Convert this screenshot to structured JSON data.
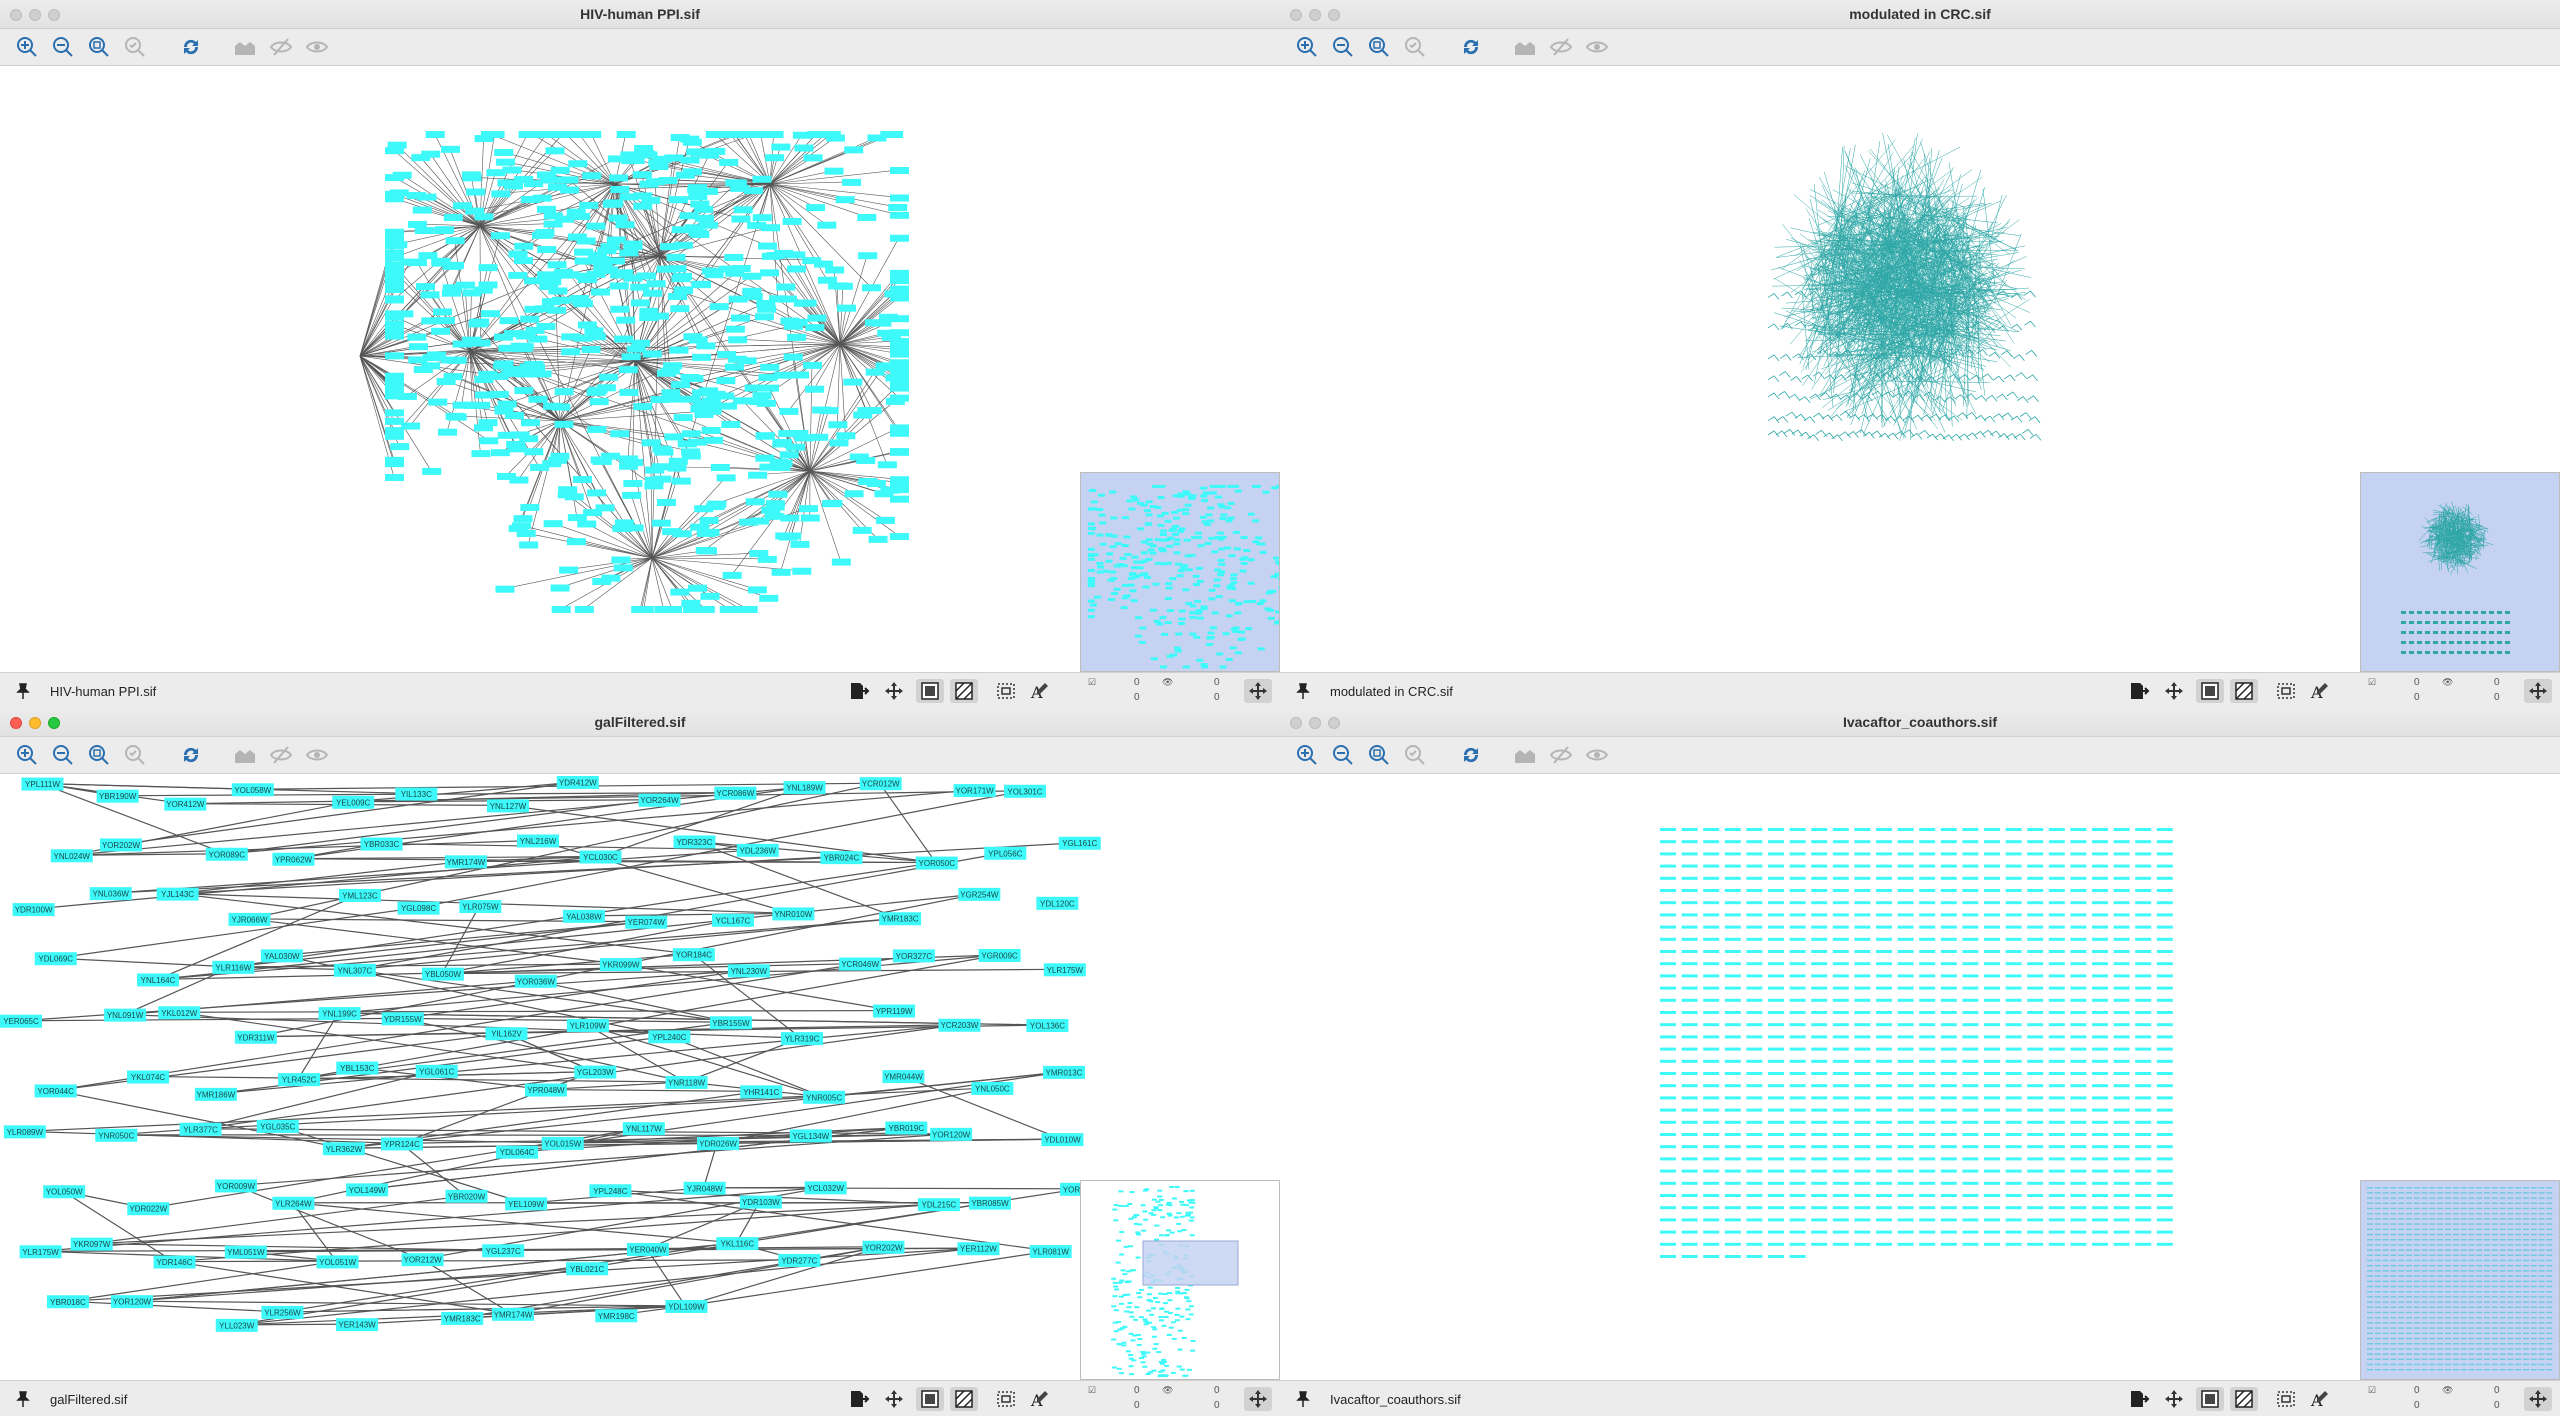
{
  "windows": [
    {
      "id": "w1",
      "title": "HIV-human PPI.sif",
      "network_name": "HIV-human PPI.sif",
      "active": false,
      "node_count_top": "0",
      "node_count_bottom": "0",
      "edge_count_top": "0",
      "edge_count_bottom": "0"
    },
    {
      "id": "w2",
      "title": "modulated in CRC.sif",
      "network_name": "modulated in CRC.sif",
      "active": false,
      "node_count_top": "0",
      "node_count_bottom": "0",
      "edge_count_top": "0",
      "edge_count_bottom": "0"
    },
    {
      "id": "w3",
      "title": "galFiltered.sif",
      "network_name": "galFiltered.sif",
      "active": true,
      "node_count_top": "0",
      "node_count_bottom": "0",
      "edge_count_top": "0",
      "edge_count_bottom": "0"
    },
    {
      "id": "w4",
      "title": "Ivacaftor_coauthors.sif",
      "network_name": "Ivacaftor_coauthors.sif",
      "active": false,
      "node_count_top": "0",
      "node_count_bottom": "0",
      "edge_count_top": "0",
      "edge_count_bottom": "0"
    }
  ],
  "toolbar_icons": [
    "zoom-in-icon",
    "zoom-out-icon",
    "zoom-fit-icon",
    "zoom-selected-icon",
    "refresh-icon",
    "show-all-icon",
    "hide-selected-icon",
    "show-selected-icon"
  ],
  "status_icons": [
    "export-icon",
    "center-icon",
    "graphics-detail-icon",
    "graphics-hide-icon",
    "marquee-icon",
    "annotation-icon"
  ],
  "colors": {
    "node_fill": "#3ef9f9",
    "edge": "#555555",
    "titlebar": "#e6e6e6",
    "birdseye_selection": "#c6d2f2"
  },
  "gal_nodes": [
    [
      "YPL111W",
      0
    ],
    [
      "YBR190W",
      0
    ],
    [
      "YOR412W",
      0
    ],
    [
      "YOL058W",
      0
    ],
    [
      "YEL009C",
      0
    ],
    [
      "YIL133C",
      0
    ],
    [
      "YNL127W",
      0
    ],
    [
      "YDR412W",
      0
    ],
    [
      "YOR264W",
      0
    ],
    [
      "YCR086W",
      0
    ],
    [
      "YNL189W",
      0
    ],
    [
      "YCR012W",
      0
    ],
    [
      "YOR171W",
      0
    ],
    [
      "YOL301C",
      0
    ],
    [
      "YNL024W",
      0
    ],
    [
      "YOR202W",
      0
    ],
    [
      "YOR089C",
      0
    ],
    [
      "YPR062W",
      0
    ],
    [
      "YBR033C",
      0
    ],
    [
      "YMR174W",
      0
    ],
    [
      "YNL216W",
      0
    ],
    [
      "YCL030C",
      0
    ],
    [
      "YDR323C",
      0
    ],
    [
      "YDL236W",
      0
    ],
    [
      "YBR024C",
      0
    ],
    [
      "YOR050C",
      0
    ],
    [
      "YPL056C",
      0
    ],
    [
      "YGL161C",
      0
    ],
    [
      "YDR100W",
      0
    ],
    [
      "YNL036W",
      0
    ],
    [
      "YJL143C",
      0
    ],
    [
      "YJR066W",
      0
    ],
    [
      "YML123C",
      0
    ],
    [
      "YGL098C",
      0
    ],
    [
      "YLR075W",
      0
    ],
    [
      "YAL038W",
      0
    ],
    [
      "YER074W",
      0
    ],
    [
      "YCL167C",
      0
    ],
    [
      "YNR010W",
      0
    ],
    [
      "YMR183C",
      0
    ],
    [
      "YGR254W",
      0
    ],
    [
      "YDL120C",
      0
    ],
    [
      "YDL069C",
      0
    ],
    [
      "YNL164C",
      0
    ],
    [
      "YLR116W",
      0
    ],
    [
      "YAL030W",
      0
    ],
    [
      "YNL307C",
      0
    ],
    [
      "YBL050W",
      0
    ],
    [
      "YOR036W",
      0
    ],
    [
      "YKR099W",
      0
    ],
    [
      "YOR184C",
      0
    ],
    [
      "YNL230W",
      0
    ],
    [
      "YCR046W",
      0
    ],
    [
      "YOR327C",
      0
    ],
    [
      "YGR009C",
      0
    ],
    [
      "YLR175W",
      0
    ],
    [
      "YER065C",
      0
    ],
    [
      "YNL091W",
      0
    ],
    [
      "YKL012W",
      0
    ],
    [
      "YDR311W",
      0
    ],
    [
      "YNL199C",
      0
    ],
    [
      "YDR155W",
      0
    ],
    [
      "YIL162V",
      0
    ],
    [
      "YLR109W",
      0
    ],
    [
      "YPL240C",
      0
    ],
    [
      "YBR155W",
      0
    ],
    [
      "YLR319C",
      0
    ],
    [
      "YPR119W",
      0
    ],
    [
      "YCR203W",
      0
    ],
    [
      "YOL136C",
      0
    ],
    [
      "YOR044C",
      0
    ],
    [
      "YKL074C",
      0
    ],
    [
      "YMR186W",
      0
    ],
    [
      "YLR452C",
      0
    ],
    [
      "YBL153C",
      0
    ],
    [
      "YGL061C",
      0
    ],
    [
      "YPR048W",
      0
    ],
    [
      "YGL203W",
      0
    ],
    [
      "YNR118W",
      0
    ],
    [
      "YHR141C",
      0
    ],
    [
      "YNR005C",
      0
    ],
    [
      "YMR044W",
      0
    ],
    [
      "YNL050C",
      0
    ],
    [
      "YMR013C",
      0
    ],
    [
      "YLR089W",
      0
    ],
    [
      "YNR050C",
      0
    ],
    [
      "YLR377C",
      0
    ],
    [
      "YGL035C",
      0
    ],
    [
      "YLR362W",
      0
    ],
    [
      "YPR124C",
      0
    ],
    [
      "YDL064C",
      0
    ],
    [
      "YOL015W",
      0
    ],
    [
      "YNL117W",
      0
    ],
    [
      "YDR026W",
      0
    ],
    [
      "YGL134W",
      0
    ],
    [
      "YBR019C",
      0
    ],
    [
      "YOR120W",
      0
    ],
    [
      "YDL010W",
      0
    ],
    [
      "YOL050W",
      0
    ],
    [
      "YDR022W",
      0
    ],
    [
      "YOR009W",
      0
    ],
    [
      "YLR264W",
      0
    ],
    [
      "YOL149W",
      0
    ],
    [
      "YBR020W",
      0
    ],
    [
      "YEL109W",
      0
    ],
    [
      "YPL248C",
      0
    ],
    [
      "YJR048W",
      0
    ],
    [
      "YDR103W",
      0
    ],
    [
      "YCL032W",
      0
    ],
    [
      "YDL215C",
      0
    ],
    [
      "YBR085W",
      0
    ],
    [
      "YOR167C",
      0
    ],
    [
      "YLR175W",
      0
    ],
    [
      "YKR097W",
      0
    ],
    [
      "YDR146C",
      0
    ],
    [
      "YML051W",
      0
    ],
    [
      "YOL051W",
      0
    ],
    [
      "YOR212W",
      0
    ],
    [
      "YGL237C",
      0
    ],
    [
      "YBL021C",
      0
    ],
    [
      "YER040W",
      0
    ],
    [
      "YKL116C",
      0
    ],
    [
      "YDR277C",
      0
    ],
    [
      "YOR202W",
      0
    ],
    [
      "YER112W",
      0
    ],
    [
      "YLR081W",
      0
    ],
    [
      "YBR018C",
      0
    ],
    [
      "YOR120W",
      0
    ],
    [
      "YLL023W",
      0
    ],
    [
      "YLR256W",
      0
    ],
    [
      "YER143W",
      0
    ],
    [
      "YMR183C",
      0
    ],
    [
      "YMR174W",
      0
    ],
    [
      "YMR198C",
      0
    ],
    [
      "YDL109W",
      0
    ]
  ]
}
